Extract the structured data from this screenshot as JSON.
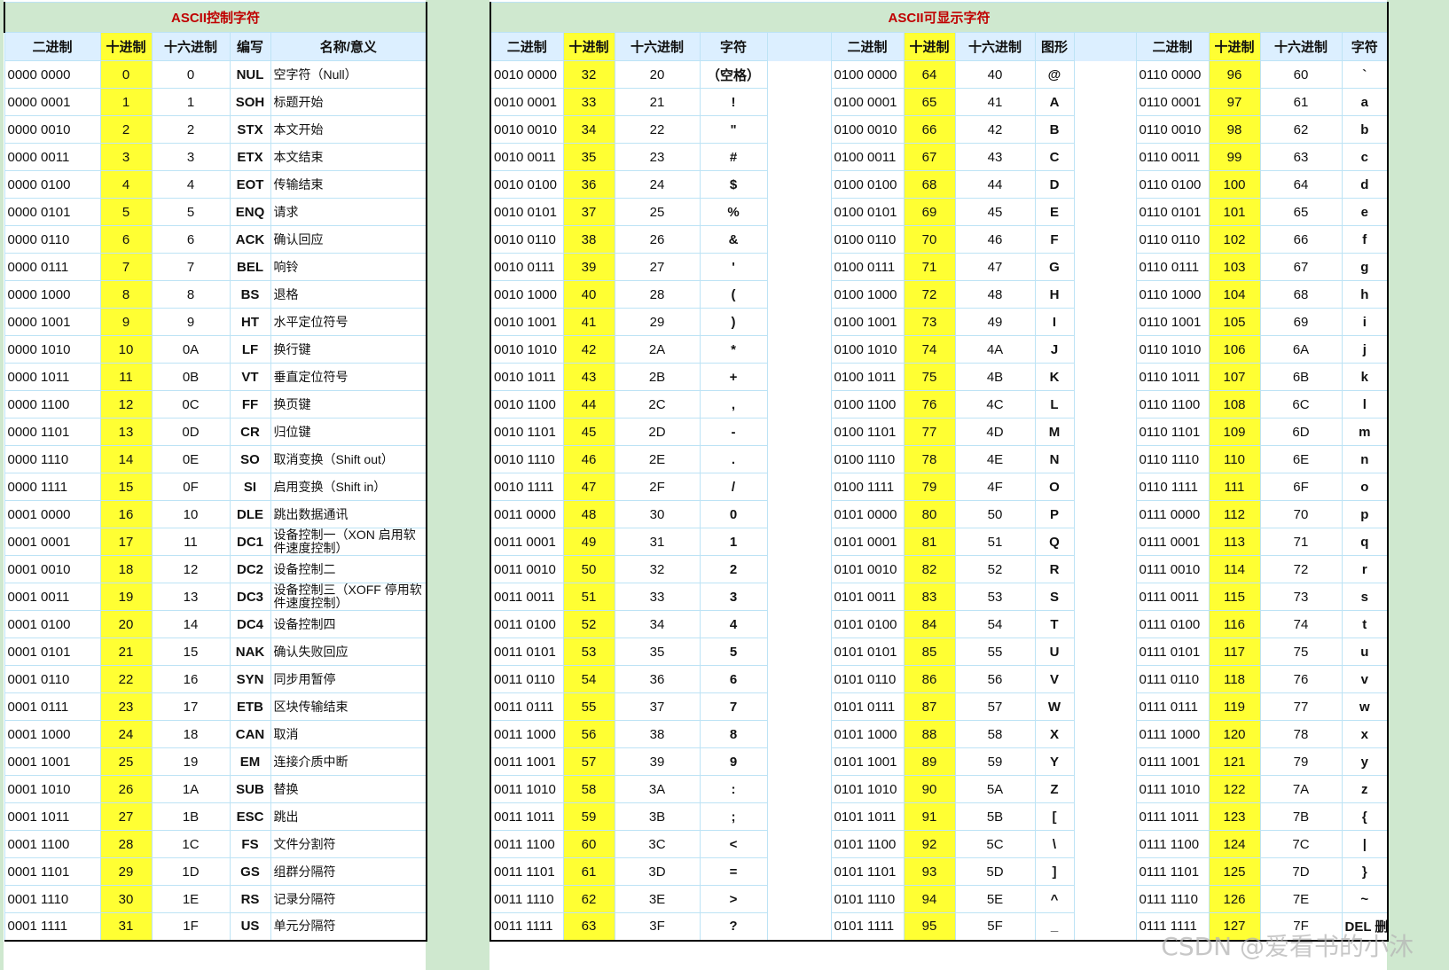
{
  "control_table": {
    "title": "ASCII控制字符",
    "headers": [
      "二进制",
      "十进制",
      "十六进制",
      "编写",
      "名称/意义"
    ],
    "rows": [
      [
        "0000 0000",
        "0",
        "0",
        "NUL",
        "空字符（Null）"
      ],
      [
        "0000 0001",
        "1",
        "1",
        "SOH",
        "标题开始"
      ],
      [
        "0000 0010",
        "2",
        "2",
        "STX",
        "本文开始"
      ],
      [
        "0000 0011",
        "3",
        "3",
        "ETX",
        "本文结束"
      ],
      [
        "0000 0100",
        "4",
        "4",
        "EOT",
        "传输结束"
      ],
      [
        "0000 0101",
        "5",
        "5",
        "ENQ",
        "请求"
      ],
      [
        "0000 0110",
        "6",
        "6",
        "ACK",
        "确认回应"
      ],
      [
        "0000 0111",
        "7",
        "7",
        "BEL",
        "响铃"
      ],
      [
        "0000 1000",
        "8",
        "8",
        "BS",
        "退格"
      ],
      [
        "0000 1001",
        "9",
        "9",
        "HT",
        "水平定位符号"
      ],
      [
        "0000 1010",
        "10",
        "0A",
        "LF",
        "换行键"
      ],
      [
        "0000 1011",
        "11",
        "0B",
        "VT",
        "垂直定位符号"
      ],
      [
        "0000 1100",
        "12",
        "0C",
        "FF",
        "换页键"
      ],
      [
        "0000 1101",
        "13",
        "0D",
        "CR",
        "归位键"
      ],
      [
        "0000 1110",
        "14",
        "0E",
        "SO",
        "取消变换（Shift out）"
      ],
      [
        "0000 1111",
        "15",
        "0F",
        "SI",
        "启用变换（Shift in）"
      ],
      [
        "0001 0000",
        "16",
        "10",
        "DLE",
        "跳出数据通讯"
      ],
      [
        "0001 0001",
        "17",
        "11",
        "DC1",
        "设备控制一（XON 启用软件速度控制）"
      ],
      [
        "0001 0010",
        "18",
        "12",
        "DC2",
        "设备控制二"
      ],
      [
        "0001 0011",
        "19",
        "13",
        "DC3",
        "设备控制三（XOFF 停用软件速度控制）"
      ],
      [
        "0001 0100",
        "20",
        "14",
        "DC4",
        "设备控制四"
      ],
      [
        "0001 0101",
        "21",
        "15",
        "NAK",
        "确认失败回应"
      ],
      [
        "0001 0110",
        "22",
        "16",
        "SYN",
        "同步用暂停"
      ],
      [
        "0001 0111",
        "23",
        "17",
        "ETB",
        "区块传输结束"
      ],
      [
        "0001 1000",
        "24",
        "18",
        "CAN",
        "取消"
      ],
      [
        "0001 1001",
        "25",
        "19",
        "EM",
        "连接介质中断"
      ],
      [
        "0001 1010",
        "26",
        "1A",
        "SUB",
        "替换"
      ],
      [
        "0001 1011",
        "27",
        "1B",
        "ESC",
        "跳出"
      ],
      [
        "0001 1100",
        "28",
        "1C",
        "FS",
        "文件分割符"
      ],
      [
        "0001 1101",
        "29",
        "1D",
        "GS",
        "组群分隔符"
      ],
      [
        "0001 1110",
        "30",
        "1E",
        "RS",
        "记录分隔符"
      ],
      [
        "0001 1111",
        "31",
        "1F",
        "US",
        "单元分隔符"
      ]
    ]
  },
  "printable_title": "ASCII可显示字符",
  "printable_blocks": [
    {
      "headers": [
        "二进制",
        "十进制",
        "十六进制",
        "字符"
      ],
      "rows": [
        [
          "0010 0000",
          "32",
          "20",
          "（空格）"
        ],
        [
          "0010 0001",
          "33",
          "21",
          "!"
        ],
        [
          "0010 0010",
          "34",
          "22",
          "\""
        ],
        [
          "0010 0011",
          "35",
          "23",
          "#"
        ],
        [
          "0010 0100",
          "36",
          "24",
          "$"
        ],
        [
          "0010 0101",
          "37",
          "25",
          "%"
        ],
        [
          "0010 0110",
          "38",
          "26",
          "&"
        ],
        [
          "0010 0111",
          "39",
          "27",
          "'"
        ],
        [
          "0010 1000",
          "40",
          "28",
          "("
        ],
        [
          "0010 1001",
          "41",
          "29",
          ")"
        ],
        [
          "0010 1010",
          "42",
          "2A",
          "*"
        ],
        [
          "0010 1011",
          "43",
          "2B",
          "+"
        ],
        [
          "0010 1100",
          "44",
          "2C",
          ","
        ],
        [
          "0010 1101",
          "45",
          "2D",
          "-"
        ],
        [
          "0010 1110",
          "46",
          "2E",
          "."
        ],
        [
          "0010 1111",
          "47",
          "2F",
          "/"
        ],
        [
          "0011 0000",
          "48",
          "30",
          "0"
        ],
        [
          "0011 0001",
          "49",
          "31",
          "1"
        ],
        [
          "0011 0010",
          "50",
          "32",
          "2"
        ],
        [
          "0011 0011",
          "51",
          "33",
          "3"
        ],
        [
          "0011 0100",
          "52",
          "34",
          "4"
        ],
        [
          "0011 0101",
          "53",
          "35",
          "5"
        ],
        [
          "0011 0110",
          "54",
          "36",
          "6"
        ],
        [
          "0011 0111",
          "55",
          "37",
          "7"
        ],
        [
          "0011 1000",
          "56",
          "38",
          "8"
        ],
        [
          "0011 1001",
          "57",
          "39",
          "9"
        ],
        [
          "0011 1010",
          "58",
          "3A",
          ":"
        ],
        [
          "0011 1011",
          "59",
          "3B",
          ";"
        ],
        [
          "0011 1100",
          "60",
          "3C",
          "<"
        ],
        [
          "0011 1101",
          "61",
          "3D",
          "="
        ],
        [
          "0011 1110",
          "62",
          "3E",
          ">"
        ],
        [
          "0011 1111",
          "63",
          "3F",
          "?"
        ]
      ]
    },
    {
      "headers": [
        "二进制",
        "十进制",
        "十六进制",
        "图形"
      ],
      "rows": [
        [
          "0100 0000",
          "64",
          "40",
          "@"
        ],
        [
          "0100 0001",
          "65",
          "41",
          "A"
        ],
        [
          "0100 0010",
          "66",
          "42",
          "B"
        ],
        [
          "0100 0011",
          "67",
          "43",
          "C"
        ],
        [
          "0100 0100",
          "68",
          "44",
          "D"
        ],
        [
          "0100 0101",
          "69",
          "45",
          "E"
        ],
        [
          "0100 0110",
          "70",
          "46",
          "F"
        ],
        [
          "0100 0111",
          "71",
          "47",
          "G"
        ],
        [
          "0100 1000",
          "72",
          "48",
          "H"
        ],
        [
          "0100 1001",
          "73",
          "49",
          "I"
        ],
        [
          "0100 1010",
          "74",
          "4A",
          "J"
        ],
        [
          "0100 1011",
          "75",
          "4B",
          "K"
        ],
        [
          "0100 1100",
          "76",
          "4C",
          "L"
        ],
        [
          "0100 1101",
          "77",
          "4D",
          "M"
        ],
        [
          "0100 1110",
          "78",
          "4E",
          "N"
        ],
        [
          "0100 1111",
          "79",
          "4F",
          "O"
        ],
        [
          "0101 0000",
          "80",
          "50",
          "P"
        ],
        [
          "0101 0001",
          "81",
          "51",
          "Q"
        ],
        [
          "0101 0010",
          "82",
          "52",
          "R"
        ],
        [
          "0101 0011",
          "83",
          "53",
          "S"
        ],
        [
          "0101 0100",
          "84",
          "54",
          "T"
        ],
        [
          "0101 0101",
          "85",
          "55",
          "U"
        ],
        [
          "0101 0110",
          "86",
          "56",
          "V"
        ],
        [
          "0101 0111",
          "87",
          "57",
          "W"
        ],
        [
          "0101 1000",
          "88",
          "58",
          "X"
        ],
        [
          "0101 1001",
          "89",
          "59",
          "Y"
        ],
        [
          "0101 1010",
          "90",
          "5A",
          "Z"
        ],
        [
          "0101 1011",
          "91",
          "5B",
          "["
        ],
        [
          "0101 1100",
          "92",
          "5C",
          "\\"
        ],
        [
          "0101 1101",
          "93",
          "5D",
          "]"
        ],
        [
          "0101 1110",
          "94",
          "5E",
          "^"
        ],
        [
          "0101 1111",
          "95",
          "5F",
          "_"
        ]
      ]
    },
    {
      "headers": [
        "二进制",
        "十进制",
        "十六进制",
        "字符"
      ],
      "rows": [
        [
          "0110 0000",
          "96",
          "60",
          "`"
        ],
        [
          "0110 0001",
          "97",
          "61",
          "a"
        ],
        [
          "0110 0010",
          "98",
          "62",
          "b"
        ],
        [
          "0110 0011",
          "99",
          "63",
          "c"
        ],
        [
          "0110 0100",
          "100",
          "64",
          "d"
        ],
        [
          "0110 0101",
          "101",
          "65",
          "e"
        ],
        [
          "0110 0110",
          "102",
          "66",
          "f"
        ],
        [
          "0110 0111",
          "103",
          "67",
          "g"
        ],
        [
          "0110 1000",
          "104",
          "68",
          "h"
        ],
        [
          "0110 1001",
          "105",
          "69",
          "i"
        ],
        [
          "0110 1010",
          "106",
          "6A",
          "j"
        ],
        [
          "0110 1011",
          "107",
          "6B",
          "k"
        ],
        [
          "0110 1100",
          "108",
          "6C",
          "l"
        ],
        [
          "0110 1101",
          "109",
          "6D",
          "m"
        ],
        [
          "0110 1110",
          "110",
          "6E",
          "n"
        ],
        [
          "0110 1111",
          "111",
          "6F",
          "o"
        ],
        [
          "0111 0000",
          "112",
          "70",
          "p"
        ],
        [
          "0111 0001",
          "113",
          "71",
          "q"
        ],
        [
          "0111 0010",
          "114",
          "72",
          "r"
        ],
        [
          "0111 0011",
          "115",
          "73",
          "s"
        ],
        [
          "0111 0100",
          "116",
          "74",
          "t"
        ],
        [
          "0111 0101",
          "117",
          "75",
          "u"
        ],
        [
          "0111 0110",
          "118",
          "76",
          "v"
        ],
        [
          "0111 0111",
          "119",
          "77",
          "w"
        ],
        [
          "0111 1000",
          "120",
          "78",
          "x"
        ],
        [
          "0111 1001",
          "121",
          "79",
          "y"
        ],
        [
          "0111 1010",
          "122",
          "7A",
          "z"
        ],
        [
          "0111 1011",
          "123",
          "7B",
          "{"
        ],
        [
          "0111 1100",
          "124",
          "7C",
          "|"
        ],
        [
          "0111 1101",
          "125",
          "7D",
          "}"
        ],
        [
          "0111 1110",
          "126",
          "7E",
          "~"
        ],
        [
          "0111 1111",
          "127",
          "7F",
          "DEL 删除"
        ]
      ]
    }
  ],
  "watermark": "CSDN @爱看书的小沐"
}
